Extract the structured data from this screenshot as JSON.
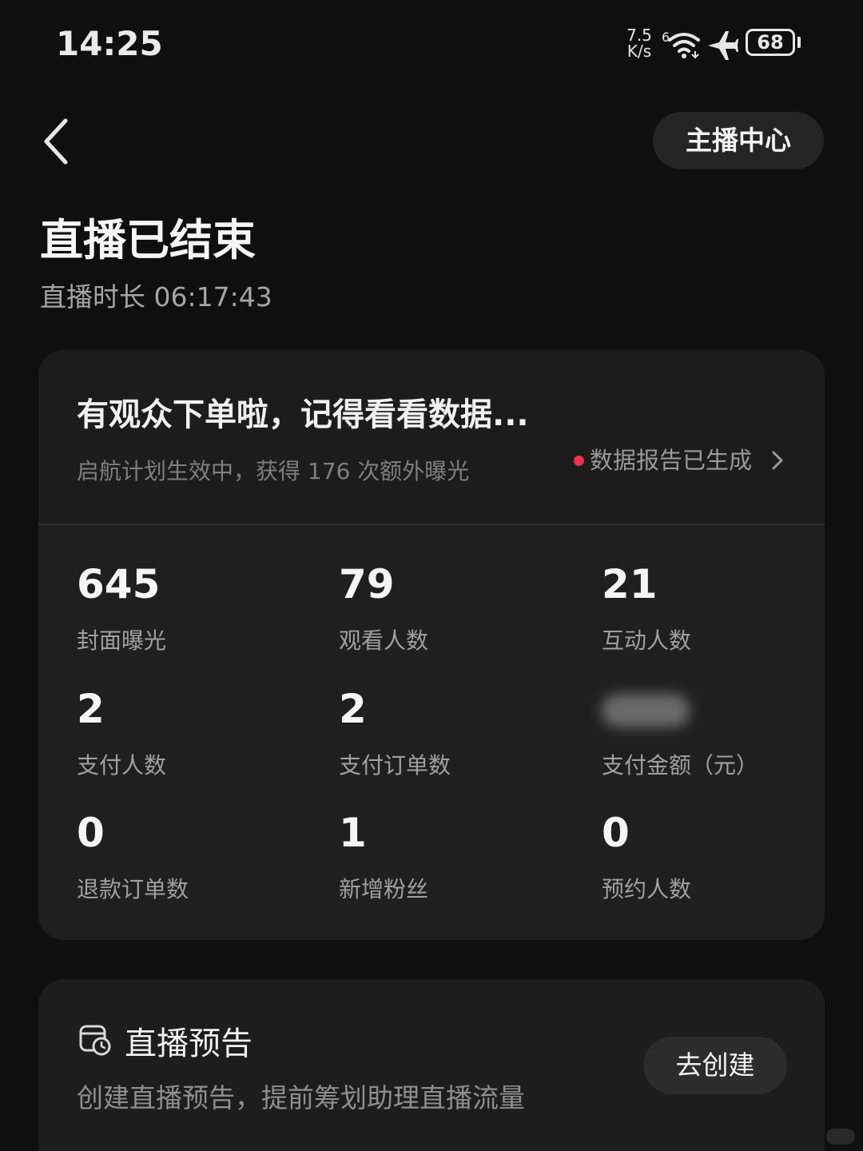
{
  "status_bar": {
    "time": "14:25",
    "net_speed_value": "7.5",
    "net_speed_unit": "K/s",
    "wifi_badge": "6",
    "battery": "68"
  },
  "nav": {
    "anchor_center_label": "主播中心"
  },
  "header": {
    "title": "直播已结束",
    "duration": "直播时长 06:17:43"
  },
  "summary": {
    "headline": "有观众下单啦，记得看看数据...",
    "subline": "启航计划生效中，获得 176 次额外曝光",
    "report_link": "数据报告已生成",
    "report_dot_color": "#f0314e"
  },
  "stats": [
    {
      "value": "645",
      "label": "封面曝光"
    },
    {
      "value": "79",
      "label": "观看人数"
    },
    {
      "value": "21",
      "label": "互动人数"
    },
    {
      "value": "2",
      "label": "支付人数"
    },
    {
      "value": "2",
      "label": "支付订单数"
    },
    {
      "value": "",
      "label": "支付金额（元）"
    },
    {
      "value": "0",
      "label": "退款订单数"
    },
    {
      "value": "1",
      "label": "新增粉丝"
    },
    {
      "value": "0",
      "label": "预约人数"
    }
  ],
  "preview": {
    "icon": "calendar-clock-icon",
    "title": "直播预告",
    "description": "创建直播预告，提前筹划助理直播流量",
    "button_label": "去创建"
  }
}
